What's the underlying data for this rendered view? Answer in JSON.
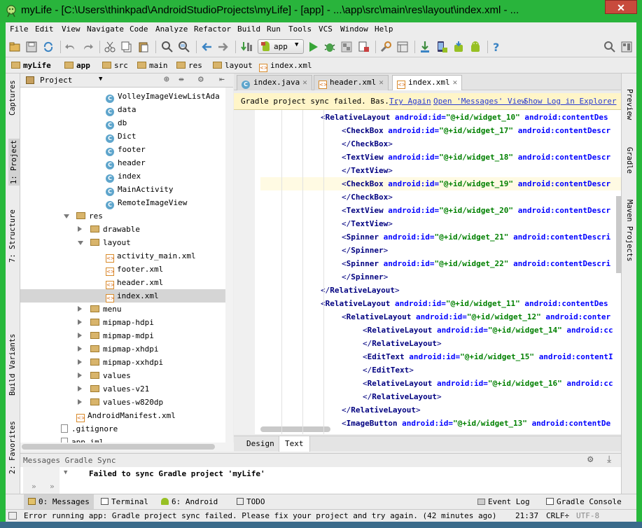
{
  "window": {
    "title": "myLife - [C:\\Users\\thinkpad\\AndroidStudioProjects\\myLife] - [app] - ...\\app\\src\\main\\res\\layout\\index.xml - ...",
    "close_label": "✕"
  },
  "menubar": {
    "items": [
      "File",
      "Edit",
      "View",
      "Navigate",
      "Code",
      "Analyze",
      "Refactor",
      "Build",
      "Run",
      "Tools",
      "VCS",
      "Window",
      "Help"
    ]
  },
  "toolbar": {
    "run_config": "app",
    "icons": [
      "open-icon",
      "save-icon",
      "sync-icon",
      "undo-icon",
      "redo-icon",
      "cut-icon",
      "copy-icon",
      "paste-icon",
      "find-icon",
      "replace-icon",
      "back-icon",
      "forward-icon",
      "make-icon",
      "run-config-icon",
      "run-icon",
      "debug-icon",
      "coverage-icon",
      "stop-icon",
      "settings-icon",
      "project-structure-icon",
      "sdk-manager-icon",
      "avd-manager-icon",
      "gradle-sync-icon",
      "android-monitor-icon",
      "help-icon",
      "search-everywhere-icon",
      "layout-icon"
    ]
  },
  "breadcrumb": [
    "myLife",
    "app",
    "src",
    "main",
    "res",
    "layout",
    "index.xml"
  ],
  "left_strip": {
    "captures": "Captures",
    "project": "1: Project",
    "structure": "7: Structure",
    "build_variants": "Build Variants",
    "favorites": "2: Favorites"
  },
  "right_strip": {
    "preview": "Preview",
    "gradle": "Gradle",
    "maven": "Maven Projects"
  },
  "project_panel": {
    "view_label": "Project",
    "tree": [
      {
        "label": "VolleyImageViewListAda",
        "kind": "class",
        "level": 3
      },
      {
        "label": "data",
        "kind": "class",
        "level": 3
      },
      {
        "label": "db",
        "kind": "class",
        "level": 3
      },
      {
        "label": "Dict",
        "kind": "class",
        "level": 3
      },
      {
        "label": "footer",
        "kind": "class",
        "level": 3
      },
      {
        "label": "header",
        "kind": "class",
        "level": 3
      },
      {
        "label": "index",
        "kind": "class",
        "level": 3
      },
      {
        "label": "MainActivity",
        "kind": "class",
        "level": 3
      },
      {
        "label": "RemoteImageView",
        "kind": "class",
        "level": 3
      },
      {
        "label": "res",
        "kind": "folder",
        "level": 1,
        "expanded": true
      },
      {
        "label": "drawable",
        "kind": "folder",
        "level": 2,
        "expanded": false
      },
      {
        "label": "layout",
        "kind": "folder",
        "level": 2,
        "expanded": true
      },
      {
        "label": "activity_main.xml",
        "kind": "xml",
        "level": 3
      },
      {
        "label": "footer.xml",
        "kind": "xml",
        "level": 3
      },
      {
        "label": "header.xml",
        "kind": "xml",
        "level": 3
      },
      {
        "label": "index.xml",
        "kind": "xml",
        "level": 3,
        "selected": true
      },
      {
        "label": "menu",
        "kind": "folder",
        "level": 2,
        "expanded": false
      },
      {
        "label": "mipmap-hdpi",
        "kind": "folder",
        "level": 2,
        "expanded": false
      },
      {
        "label": "mipmap-mdpi",
        "kind": "folder",
        "level": 2,
        "expanded": false
      },
      {
        "label": "mipmap-xhdpi",
        "kind": "folder",
        "level": 2,
        "expanded": false
      },
      {
        "label": "mipmap-xxhdpi",
        "kind": "folder",
        "level": 2,
        "expanded": false
      },
      {
        "label": "values",
        "kind": "folder",
        "level": 2,
        "expanded": false
      },
      {
        "label": "values-v21",
        "kind": "folder",
        "level": 2,
        "expanded": false
      },
      {
        "label": "values-w820dp",
        "kind": "folder",
        "level": 2,
        "expanded": false
      },
      {
        "label": "AndroidManifest.xml",
        "kind": "xml",
        "level": 1
      },
      {
        "label": ".gitignore",
        "kind": "file",
        "level": 0
      },
      {
        "label": "app.iml",
        "kind": "file",
        "level": 0
      }
    ]
  },
  "editor_tabs": [
    {
      "label": "index.java",
      "active": false
    },
    {
      "label": "header.xml",
      "active": false
    },
    {
      "label": "index.xml",
      "active": true
    }
  ],
  "notification": {
    "message": "Gradle project sync failed. Bas...",
    "links": [
      "Try Again",
      "Open 'Messages' View",
      "Show Log in Explorer"
    ]
  },
  "code_lines": [
    {
      "indent": 0,
      "parts": [
        [
          "ptr",
          "<"
        ],
        [
          "tag",
          "RelativeLayout"
        ],
        [
          "txt",
          " "
        ],
        [
          "attr",
          "android:id="
        ],
        [
          "val",
          "\"@+id/widget_10\""
        ],
        [
          "txt",
          " "
        ],
        [
          "attr",
          "android:contentDes"
        ]
      ]
    },
    {
      "indent": 1,
      "parts": [
        [
          "ptr",
          "<"
        ],
        [
          "tag",
          "CheckBox"
        ],
        [
          "txt",
          " "
        ],
        [
          "attr",
          "android:id="
        ],
        [
          "val",
          "\"@+id/widget_17\""
        ],
        [
          "txt",
          " "
        ],
        [
          "attr",
          "android:contentDescr"
        ]
      ]
    },
    {
      "indent": 1,
      "parts": [
        [
          "ptr",
          "</"
        ],
        [
          "tag",
          "CheckBox"
        ],
        [
          "ptr",
          ">"
        ]
      ]
    },
    {
      "indent": 1,
      "parts": [
        [
          "ptr",
          "<"
        ],
        [
          "tag",
          "TextView"
        ],
        [
          "txt",
          " "
        ],
        [
          "attr",
          "android:id="
        ],
        [
          "val",
          "\"@+id/widget_18\""
        ],
        [
          "txt",
          " "
        ],
        [
          "attr",
          "android:contentDescr"
        ]
      ]
    },
    {
      "indent": 1,
      "parts": [
        [
          "ptr",
          "</"
        ],
        [
          "tag",
          "TextView"
        ],
        [
          "ptr",
          ">"
        ]
      ]
    },
    {
      "indent": 1,
      "current": true,
      "parts": [
        [
          "ptr",
          "<"
        ],
        [
          "tag",
          "CheckBox"
        ],
        [
          "txt",
          " "
        ],
        [
          "attr",
          "android:id="
        ],
        [
          "val",
          "\"@+id/widget_19\""
        ],
        [
          "txt",
          " "
        ],
        [
          "attr",
          "android:contentDescr"
        ]
      ]
    },
    {
      "indent": 1,
      "parts": [
        [
          "ptr",
          "</"
        ],
        [
          "tag",
          "CheckBox"
        ],
        [
          "ptr",
          ">"
        ]
      ]
    },
    {
      "indent": 1,
      "parts": [
        [
          "ptr",
          "<"
        ],
        [
          "tag",
          "TextView"
        ],
        [
          "txt",
          " "
        ],
        [
          "attr",
          "android:id="
        ],
        [
          "val",
          "\"@+id/widget_20\""
        ],
        [
          "txt",
          " "
        ],
        [
          "attr",
          "android:contentDescr"
        ]
      ]
    },
    {
      "indent": 1,
      "parts": [
        [
          "ptr",
          "</"
        ],
        [
          "tag",
          "TextView"
        ],
        [
          "ptr",
          ">"
        ]
      ]
    },
    {
      "indent": 1,
      "parts": [
        [
          "ptr",
          "<"
        ],
        [
          "tag",
          "Spinner"
        ],
        [
          "txt",
          " "
        ],
        [
          "attr",
          "android:id="
        ],
        [
          "val",
          "\"@+id/widget_21\""
        ],
        [
          "txt",
          " "
        ],
        [
          "attr",
          "android:contentDescri"
        ]
      ]
    },
    {
      "indent": 1,
      "parts": [
        [
          "ptr",
          "</"
        ],
        [
          "tag",
          "Spinner"
        ],
        [
          "ptr",
          ">"
        ]
      ]
    },
    {
      "indent": 1,
      "parts": [
        [
          "ptr",
          "<"
        ],
        [
          "tag",
          "Spinner"
        ],
        [
          "txt",
          " "
        ],
        [
          "attr",
          "android:id="
        ],
        [
          "val",
          "\"@+id/widget_22\""
        ],
        [
          "txt",
          " "
        ],
        [
          "attr",
          "android:contentDescri"
        ]
      ]
    },
    {
      "indent": 1,
      "parts": [
        [
          "ptr",
          "</"
        ],
        [
          "tag",
          "Spinner"
        ],
        [
          "ptr",
          ">"
        ]
      ]
    },
    {
      "indent": 0,
      "parts": [
        [
          "ptr",
          "</"
        ],
        [
          "tag",
          "RelativeLayout"
        ],
        [
          "ptr",
          ">"
        ]
      ]
    },
    {
      "indent": 0,
      "parts": [
        [
          "ptr",
          "<"
        ],
        [
          "tag",
          "RelativeLayout"
        ],
        [
          "txt",
          " "
        ],
        [
          "attr",
          "android:id="
        ],
        [
          "val",
          "\"@+id/widget_11\""
        ],
        [
          "txt",
          " "
        ],
        [
          "attr",
          "android:contentDes"
        ]
      ]
    },
    {
      "indent": 1,
      "parts": [
        [
          "ptr",
          "<"
        ],
        [
          "tag",
          "RelativeLayout"
        ],
        [
          "txt",
          " "
        ],
        [
          "attr",
          "android:id="
        ],
        [
          "val",
          "\"@+id/widget_12\""
        ],
        [
          "txt",
          " "
        ],
        [
          "attr",
          "android:conter"
        ]
      ]
    },
    {
      "indent": 2,
      "parts": [
        [
          "ptr",
          "<"
        ],
        [
          "tag",
          "RelativeLayout"
        ],
        [
          "txt",
          " "
        ],
        [
          "attr",
          "android:id="
        ],
        [
          "val",
          "\"@+id/widget_14\""
        ],
        [
          "txt",
          " "
        ],
        [
          "attr",
          "android:cc"
        ]
      ]
    },
    {
      "indent": 2,
      "parts": [
        [
          "ptr",
          "</"
        ],
        [
          "tag",
          "RelativeLayout"
        ],
        [
          "ptr",
          ">"
        ]
      ]
    },
    {
      "indent": 2,
      "parts": [
        [
          "ptr",
          "<"
        ],
        [
          "tag",
          "EditText"
        ],
        [
          "txt",
          " "
        ],
        [
          "attr",
          "android:id="
        ],
        [
          "val",
          "\"@+id/widget_15\""
        ],
        [
          "txt",
          " "
        ],
        [
          "attr",
          "android:contentI"
        ]
      ]
    },
    {
      "indent": 2,
      "parts": [
        [
          "ptr",
          "</"
        ],
        [
          "tag",
          "EditText"
        ],
        [
          "ptr",
          ">"
        ]
      ]
    },
    {
      "indent": 2,
      "parts": [
        [
          "ptr",
          "<"
        ],
        [
          "tag",
          "RelativeLayout"
        ],
        [
          "txt",
          " "
        ],
        [
          "attr",
          "android:id="
        ],
        [
          "val",
          "\"@+id/widget_16\""
        ],
        [
          "txt",
          " "
        ],
        [
          "attr",
          "android:cc"
        ]
      ]
    },
    {
      "indent": 2,
      "parts": [
        [
          "ptr",
          "</"
        ],
        [
          "tag",
          "RelativeLayout"
        ],
        [
          "ptr",
          ">"
        ]
      ]
    },
    {
      "indent": 1,
      "parts": [
        [
          "ptr",
          "</"
        ],
        [
          "tag",
          "RelativeLayout"
        ],
        [
          "ptr",
          ">"
        ]
      ]
    },
    {
      "indent": 1,
      "parts": [
        [
          "ptr",
          "<"
        ],
        [
          "tag",
          "ImageButton"
        ],
        [
          "txt",
          " "
        ],
        [
          "attr",
          "android:id="
        ],
        [
          "val",
          "\"@+id/widget_13\""
        ],
        [
          "txt",
          " "
        ],
        [
          "attr",
          "android:contentDe"
        ]
      ]
    }
  ],
  "editor_mode_tabs": {
    "design": "Design",
    "text": "Text"
  },
  "messages_panel": {
    "title": "Messages Gradle Sync",
    "error": "Failed to sync Gradle project 'myLife'"
  },
  "tool_tabs": [
    {
      "label": "0: Messages",
      "active": true
    },
    {
      "label": "Terminal"
    },
    {
      "label": "6: Android"
    },
    {
      "label": "TODO"
    },
    {
      "label": "Event Log"
    },
    {
      "label": "Gradle Console"
    }
  ],
  "status": {
    "message": "Error running app: Gradle project sync failed. Please fix your project and try again. (42 minutes ago)",
    "position": "21:37",
    "line_sep": "CRLF÷",
    "encoding": "UTF-8"
  },
  "colors": {
    "window_frame": "#27b83b",
    "tag": "#000080",
    "attr": "#0000ff",
    "value": "#008000",
    "notice_bg": "#fff5c8",
    "link": "#2a3bd2"
  }
}
